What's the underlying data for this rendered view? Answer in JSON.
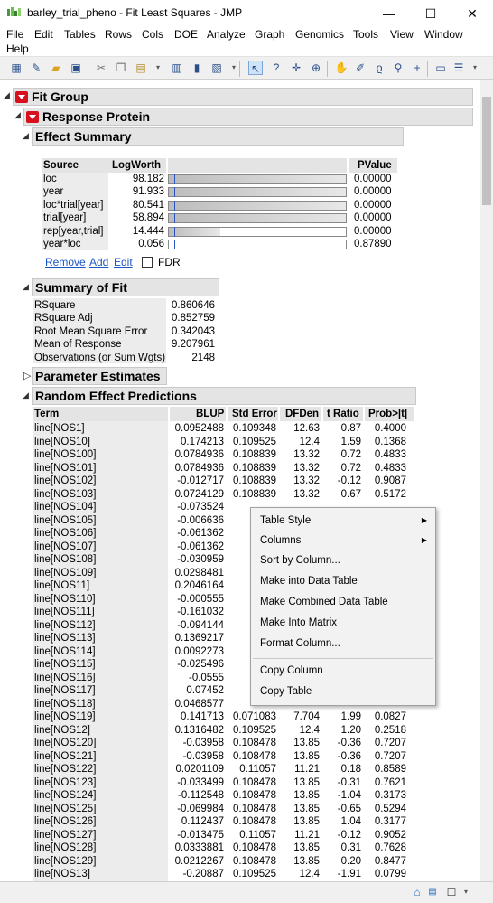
{
  "window": {
    "title": "barley_trial_pheno - Fit Least Squares - JMP",
    "minimize": "—",
    "maximize": "☐",
    "close": "✕"
  },
  "menu": [
    "File",
    "Edit",
    "Tables",
    "Rows",
    "Cols",
    "DOE",
    "Analyze",
    "Graph",
    "Genomics",
    "Tools",
    "View",
    "Window",
    "Help"
  ],
  "toolbar_icons": [
    "new-table-icon",
    "new-script-icon",
    "open-icon",
    "save-icon",
    "cut-icon",
    "copy-icon",
    "paste-icon",
    "data-table-icon",
    "distribution-icon",
    "fit-model-icon",
    "arrow-tool-icon",
    "help-tool-icon",
    "crosshair-icon",
    "target-icon",
    "grabber-icon",
    "brush-icon",
    "lasso-icon",
    "magnifier-icon",
    "plus-icon",
    "annotate-icon",
    "line-icon"
  ],
  "fit_group": {
    "title": "Fit Group"
  },
  "response": {
    "title": "Response Protein"
  },
  "effect_summary": {
    "title": "Effect Summary",
    "headers": {
      "source": "Source",
      "logworth": "LogWorth",
      "pvalue": "PValue"
    },
    "rows": [
      {
        "source": "loc",
        "logworth": "98.182",
        "pvalue": "0.00000",
        "bar": 1.0
      },
      {
        "source": "year",
        "logworth": "91.933",
        "pvalue": "0.00000",
        "bar": 1.0
      },
      {
        "source": "loc*trial[year]",
        "logworth": "80.541",
        "pvalue": "0.00000",
        "bar": 1.0
      },
      {
        "source": "trial[year]",
        "logworth": "58.894",
        "pvalue": "0.00000",
        "bar": 1.0
      },
      {
        "source": "rep[year,trial]",
        "logworth": "14.444",
        "pvalue": "0.00000",
        "bar": 0.29
      },
      {
        "source": "year*loc",
        "logworth": "0.056",
        "pvalue": "0.87890",
        "bar": 0.0
      }
    ],
    "actions": {
      "remove": "Remove",
      "add": "Add",
      "edit": "Edit",
      "fdr": "FDR"
    }
  },
  "summary_of_fit": {
    "title": "Summary of Fit",
    "rows": [
      {
        "label": "RSquare",
        "value": "0.860646"
      },
      {
        "label": "RSquare Adj",
        "value": "0.852759"
      },
      {
        "label": "Root Mean Square Error",
        "value": "0.342043"
      },
      {
        "label": "Mean of Response",
        "value": "9.207961"
      },
      {
        "label": "Observations (or Sum Wgts)",
        "value": "2148"
      }
    ]
  },
  "parameter_estimates": {
    "title": "Parameter Estimates"
  },
  "random_effects": {
    "title": "Random Effect Predictions",
    "headers": {
      "term": "Term",
      "blup": "BLUP",
      "stderr": "Std Error",
      "dfden": "DFDen",
      "tratio": "t Ratio",
      "prob": "Prob>|t|"
    },
    "rows": [
      {
        "term": "line[NOS1]",
        "blup": "0.0952488",
        "stderr": "0.109348",
        "dfden": "12.63",
        "tratio": "0.87",
        "prob": "0.4000"
      },
      {
        "term": "line[NOS10]",
        "blup": "0.174213",
        "stderr": "0.109525",
        "dfden": "12.4",
        "tratio": "1.59",
        "prob": "0.1368"
      },
      {
        "term": "line[NOS100]",
        "blup": "0.0784936",
        "stderr": "0.108839",
        "dfden": "13.32",
        "tratio": "0.72",
        "prob": "0.4833"
      },
      {
        "term": "line[NOS101]",
        "blup": "0.0784936",
        "stderr": "0.108839",
        "dfden": "13.32",
        "tratio": "0.72",
        "prob": "0.4833"
      },
      {
        "term": "line[NOS102]",
        "blup": "-0.012717",
        "stderr": "0.108839",
        "dfden": "13.32",
        "tratio": "-0.12",
        "prob": "0.9087"
      },
      {
        "term": "line[NOS103]",
        "blup": "0.0724129",
        "stderr": "0.108839",
        "dfden": "13.32",
        "tratio": "0.67",
        "prob": "0.5172"
      },
      {
        "term": "line[NOS104]",
        "blup": "-0.073524",
        "stderr": "",
        "dfden": "",
        "tratio": "",
        "prob": ""
      },
      {
        "term": "line[NOS105]",
        "blup": "-0.006636",
        "stderr": "",
        "dfden": "",
        "tratio": "",
        "prob": ""
      },
      {
        "term": "line[NOS106]",
        "blup": "-0.061362",
        "stderr": "",
        "dfden": "",
        "tratio": "",
        "prob": ""
      },
      {
        "term": "line[NOS107]",
        "blup": "-0.061362",
        "stderr": "",
        "dfden": "",
        "tratio": "",
        "prob": ""
      },
      {
        "term": "line[NOS108]",
        "blup": "-0.030959",
        "stderr": "",
        "dfden": "",
        "tratio": "",
        "prob": ""
      },
      {
        "term": "line[NOS109]",
        "blup": "0.0298481",
        "stderr": "",
        "dfden": "",
        "tratio": "",
        "prob": ""
      },
      {
        "term": "line[NOS11]",
        "blup": "0.2046164",
        "stderr": "",
        "dfden": "",
        "tratio": "",
        "prob": ""
      },
      {
        "term": "line[NOS110]",
        "blup": "-0.000555",
        "stderr": "",
        "dfden": "",
        "tratio": "",
        "prob": ""
      },
      {
        "term": "line[NOS111]",
        "blup": "-0.161032",
        "stderr": "",
        "dfden": "",
        "tratio": "",
        "prob": ""
      },
      {
        "term": "line[NOS112]",
        "blup": "-0.094144",
        "stderr": "",
        "dfden": "",
        "tratio": "",
        "prob": ""
      },
      {
        "term": "line[NOS113]",
        "blup": "0.1369217",
        "stderr": "",
        "dfden": "",
        "tratio": "",
        "prob": ""
      },
      {
        "term": "line[NOS114]",
        "blup": "0.0092273",
        "stderr": "",
        "dfden": "",
        "tratio": "",
        "prob": ""
      },
      {
        "term": "line[NOS115]",
        "blup": "-0.025496",
        "stderr": "",
        "dfden": "",
        "tratio": "",
        "prob": ""
      },
      {
        "term": "line[NOS116]",
        "blup": "-0.0555",
        "stderr": "",
        "dfden": "",
        "tratio": "",
        "prob": ""
      },
      {
        "term": "line[NOS117]",
        "blup": "0.07452",
        "stderr": "",
        "dfden": "",
        "tratio": "",
        "prob": ""
      },
      {
        "term": "line[NOS118]",
        "blup": "0.0468577",
        "stderr": "",
        "dfden": "",
        "tratio": "",
        "prob": ""
      },
      {
        "term": "line[NOS119]",
        "blup": "0.141713",
        "stderr": "0.071083",
        "dfden": "7.704",
        "tratio": "1.99",
        "prob": "0.0827"
      },
      {
        "term": "line[NOS12]",
        "blup": "0.1316482",
        "stderr": "0.109525",
        "dfden": "12.4",
        "tratio": "1.20",
        "prob": "0.2518"
      },
      {
        "term": "line[NOS120]",
        "blup": "-0.03958",
        "stderr": "0.108478",
        "dfden": "13.85",
        "tratio": "-0.36",
        "prob": "0.7207"
      },
      {
        "term": "line[NOS121]",
        "blup": "-0.03958",
        "stderr": "0.108478",
        "dfden": "13.85",
        "tratio": "-0.36",
        "prob": "0.7207"
      },
      {
        "term": "line[NOS122]",
        "blup": "0.0201109",
        "stderr": "0.11057",
        "dfden": "11.21",
        "tratio": "0.18",
        "prob": "0.8589"
      },
      {
        "term": "line[NOS123]",
        "blup": "-0.033499",
        "stderr": "0.108478",
        "dfden": "13.85",
        "tratio": "-0.31",
        "prob": "0.7621"
      },
      {
        "term": "line[NOS124]",
        "blup": "-0.112548",
        "stderr": "0.108478",
        "dfden": "13.85",
        "tratio": "-1.04",
        "prob": "0.3173"
      },
      {
        "term": "line[NOS125]",
        "blup": "-0.069984",
        "stderr": "0.108478",
        "dfden": "13.85",
        "tratio": "-0.65",
        "prob": "0.5294"
      },
      {
        "term": "line[NOS126]",
        "blup": "0.112437",
        "stderr": "0.108478",
        "dfden": "13.85",
        "tratio": "1.04",
        "prob": "0.3177"
      },
      {
        "term": "line[NOS127]",
        "blup": "-0.013475",
        "stderr": "0.11057",
        "dfden": "11.21",
        "tratio": "-0.12",
        "prob": "0.9052"
      },
      {
        "term": "line[NOS128]",
        "blup": "0.0333881",
        "stderr": "0.108478",
        "dfden": "13.85",
        "tratio": "0.31",
        "prob": "0.7628"
      },
      {
        "term": "line[NOS129]",
        "blup": "0.0212267",
        "stderr": "0.108478",
        "dfden": "13.85",
        "tratio": "0.20",
        "prob": "0.8477"
      },
      {
        "term": "line[NOS13]",
        "blup": "-0.20887",
        "stderr": "0.109525",
        "dfden": "12.4",
        "tratio": "-1.91",
        "prob": "0.0799"
      }
    ]
  },
  "context_menu": {
    "items": [
      {
        "label": "Table Style",
        "submenu": true
      },
      {
        "label": "Columns",
        "submenu": true
      },
      {
        "label": "Sort by Column...",
        "submenu": false
      },
      {
        "label": "Make into Data Table",
        "submenu": false
      },
      {
        "label": "Make Combined Data Table",
        "submenu": false
      },
      {
        "label": "Make Into Matrix",
        "submenu": false
      },
      {
        "label": "Format Column...",
        "submenu": false
      },
      {
        "label": "Copy Column",
        "submenu": false
      },
      {
        "label": "Copy Table",
        "submenu": false
      }
    ]
  },
  "colors": {
    "accent_red": "#d8101e",
    "link_blue": "#1a56c4",
    "outline_grey": "#e4e4e4"
  }
}
